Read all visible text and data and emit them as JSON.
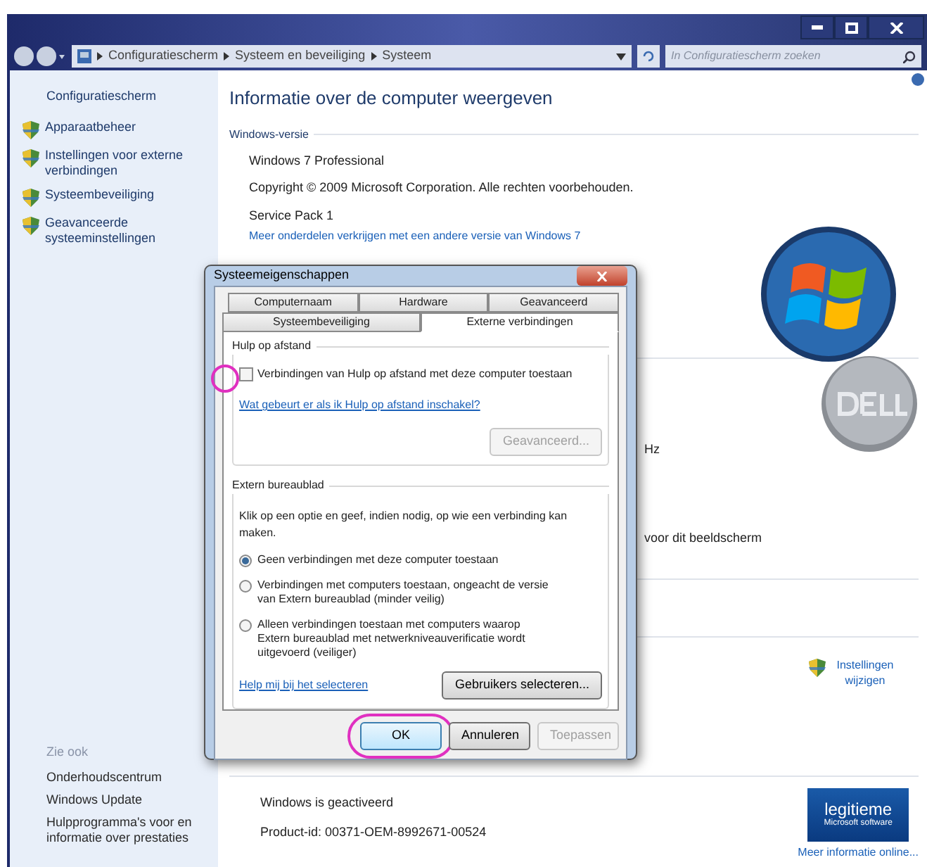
{
  "address_bar": {
    "breadcrumbs": [
      "Configuratiescherm",
      "Systeem en beveiliging",
      "Systeem"
    ],
    "search_placeholder": "In Configuratiescherm zoeken"
  },
  "sidebar": {
    "home": "Configuratiescherm",
    "items": [
      "Apparaatbeheer",
      "Instellingen voor externe verbindingen",
      "Systeembeveiliging",
      "Geavanceerde systeeminstellingen"
    ],
    "see_also_title": "Zie ook",
    "see_also": [
      "Onderhoudscentrum",
      "Windows Update",
      "Hulpprogramma's voor en informatie over prestaties"
    ]
  },
  "main": {
    "title": "Informatie over de computer weergeven",
    "section": "Windows-versie",
    "edition": "Windows 7 Professional",
    "copyright": "Copyright © 2009 Microsoft Corporation. Alle rechten voorbehouden.",
    "service_pack": "Service Pack 1",
    "upgrade_link": "Meer onderdelen verkrijgen met een andere versie van Windows 7",
    "fragment_1": "Hz",
    "fragment_2": "voor dit beeldscherm",
    "change_settings": "Instellingen wijzigen",
    "activation": "Windows is geactiveerd",
    "product_id": "Product-id: 00371-OEM-8992671-00524",
    "genuine_badge": [
      "legitieme",
      "Microsoft software"
    ],
    "more_info": "Meer informatie online..."
  },
  "dialog": {
    "title": "Systeemeigenschappen",
    "tab_rows": [
      [
        {
          "label": "Computernaam",
          "selected": false
        },
        {
          "label": "Hardware",
          "selected": false
        },
        {
          "label": "Geavanceerd",
          "selected": false
        }
      ],
      [
        {
          "label": "Systeembeveiliging",
          "selected": false
        },
        {
          "label": "Externe verbindingen",
          "selected": true
        }
      ]
    ],
    "remote_assistance": {
      "title": "Hulp op afstand",
      "checkbox": {
        "label": "Verbindingen van Hulp op afstand met deze computer toestaan",
        "checked": false
      },
      "link": "Wat gebeurt er als ik Hulp op afstand inschakel?",
      "button": {
        "label": "Geavanceerd...",
        "disabled": true
      }
    },
    "remote_desktop": {
      "title": "Extern bureaublad",
      "instruction": "Klik op een optie en geef, indien nodig, op wie een verbinding kan maken.",
      "options": [
        {
          "label": "Geen verbindingen met deze computer toestaan",
          "selected": true
        },
        {
          "label": "Verbindingen met computers toestaan, ongeacht de versie van Extern bureaublad (minder veilig)",
          "selected": false
        },
        {
          "label": "Alleen verbindingen toestaan met computers waarop Extern bureaublad met netwerkniveauverificatie wordt uitgevoerd (veiliger)",
          "selected": false
        }
      ],
      "link": "Help mij bij het selecteren",
      "button": {
        "label": "Gebruikers selecteren...",
        "disabled": false
      }
    },
    "buttons": [
      {
        "label": "OK",
        "disabled": false,
        "highlighted": true
      },
      {
        "label": "Annuleren",
        "disabled": false,
        "highlighted": false
      },
      {
        "label": "Toepassen",
        "disabled": true,
        "highlighted": false
      }
    ]
  }
}
